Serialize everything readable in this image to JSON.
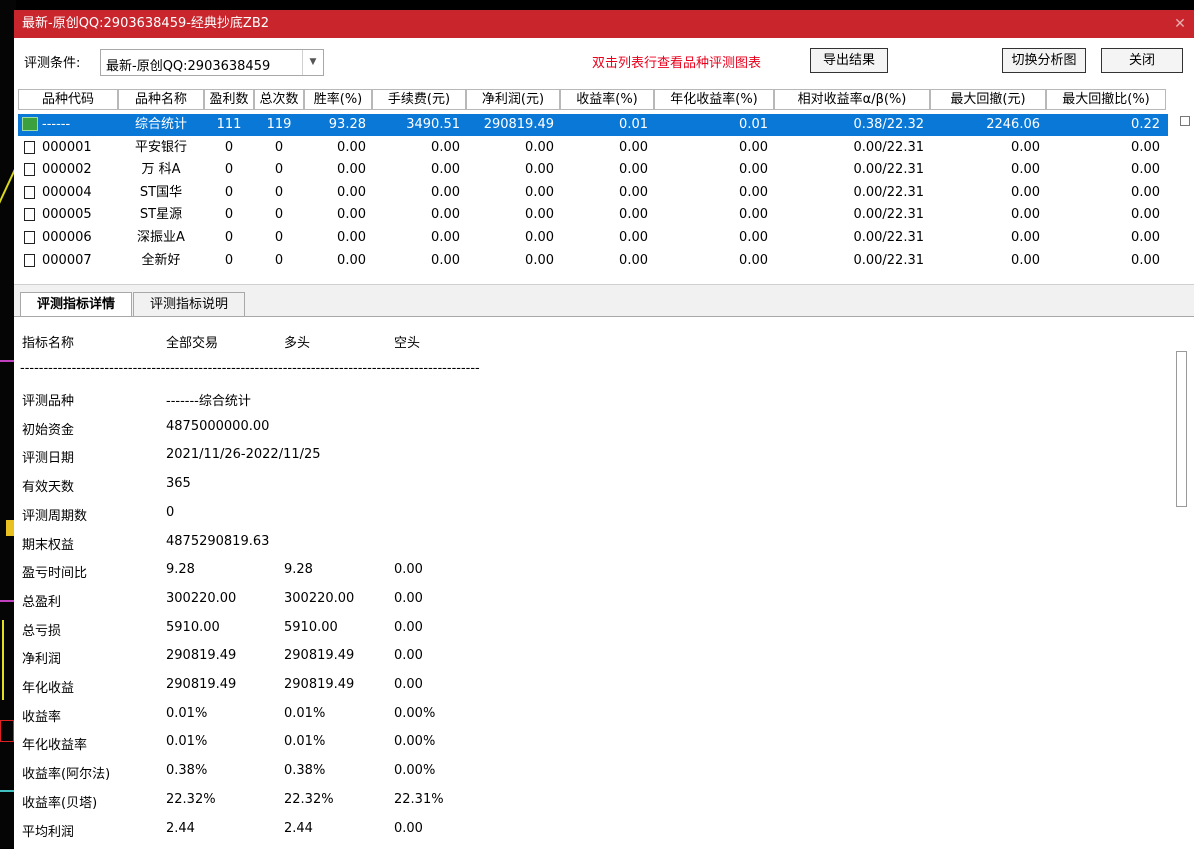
{
  "window": {
    "title": "最新-原创QQ:2903638459-经典抄底ZB2",
    "close_glyph": "✕"
  },
  "toolbar": {
    "cond_label": "评测条件:",
    "cond_value": "最新-原创QQ:2903638459",
    "hint": "双击列表行查看品种评测图表",
    "export_label": "导出结果",
    "switch_label": "切换分析图",
    "close_label": "关闭"
  },
  "table": {
    "headers": [
      "品种代码",
      "品种名称",
      "盈利数",
      "总次数",
      "胜率(%)",
      "手续费(元)",
      "净利润(元)",
      "收益率(%)",
      "年化收益率(%)",
      "相对收益率α/β(%)",
      "最大回撤(元)",
      "最大回撤比(%)"
    ],
    "rows": [
      [
        "------",
        "综合统计",
        "111",
        "119",
        "93.28",
        "3490.51",
        "290819.49",
        "0.01",
        "0.01",
        "0.38/22.32",
        "2246.06",
        "0.22"
      ],
      [
        "000001",
        "平安银行",
        "0",
        "0",
        "0.00",
        "0.00",
        "0.00",
        "0.00",
        "0.00",
        "0.00/22.31",
        "0.00",
        "0.00"
      ],
      [
        "000002",
        "万 科A",
        "0",
        "0",
        "0.00",
        "0.00",
        "0.00",
        "0.00",
        "0.00",
        "0.00/22.31",
        "0.00",
        "0.00"
      ],
      [
        "000004",
        "ST国华",
        "0",
        "0",
        "0.00",
        "0.00",
        "0.00",
        "0.00",
        "0.00",
        "0.00/22.31",
        "0.00",
        "0.00"
      ],
      [
        "000005",
        "ST星源",
        "0",
        "0",
        "0.00",
        "0.00",
        "0.00",
        "0.00",
        "0.00",
        "0.00/22.31",
        "0.00",
        "0.00"
      ],
      [
        "000006",
        "深振业A",
        "0",
        "0",
        "0.00",
        "0.00",
        "0.00",
        "0.00",
        "0.00",
        "0.00/22.31",
        "0.00",
        "0.00"
      ],
      [
        "000007",
        "全新好",
        "0",
        "0",
        "0.00",
        "0.00",
        "0.00",
        "0.00",
        "0.00",
        "0.00/22.31",
        "0.00",
        "0.00"
      ]
    ]
  },
  "tabs": [
    "评测指标详情",
    "评测指标说明"
  ],
  "detail": {
    "header": [
      "指标名称",
      "全部交易",
      "多头",
      "空头"
    ],
    "separator": "----------------------------------------------------------------------------------------------------",
    "lines": [
      [
        "评测品种",
        "-------综合统计",
        "",
        ""
      ],
      [
        "初始资金",
        "4875000000.00",
        "",
        ""
      ],
      [
        "评测日期",
        "2021/11/26-2022/11/25",
        "",
        ""
      ],
      [
        "有效天数",
        "365",
        "",
        ""
      ],
      [
        "评测周期数",
        "0",
        "",
        ""
      ],
      [
        "期末权益",
        "4875290819.63",
        "",
        ""
      ],
      [
        "盈亏时间比",
        "9.28",
        "9.28",
        "0.00"
      ],
      [
        "总盈利",
        "300220.00",
        "300220.00",
        "0.00"
      ],
      [
        "总亏损",
        "5910.00",
        "5910.00",
        "0.00"
      ],
      [
        "净利润",
        "290819.49",
        "290819.49",
        "0.00"
      ],
      [
        "年化收益",
        "290819.49",
        "290819.49",
        "0.00"
      ],
      [
        "收益率",
        "0.01%",
        "0.01%",
        "0.00%"
      ],
      [
        "年化收益率",
        "0.01%",
        "0.01%",
        "0.00%"
      ],
      [
        "收益率(阿尔法)",
        "0.38%",
        "0.38%",
        "0.00%"
      ],
      [
        "收益率(贝塔)",
        "22.32%",
        "22.32%",
        "22.31%"
      ],
      [
        "平均利润",
        "2.44",
        "2.44",
        "0.00"
      ]
    ]
  },
  "colors": {
    "title_bg": "#c8252c",
    "selection": "#0a78d7",
    "hint": "#e8001c",
    "row_icon": "#3ca03c"
  }
}
